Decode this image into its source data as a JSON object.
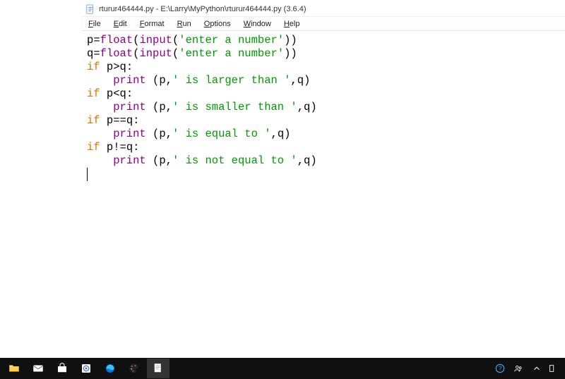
{
  "window": {
    "title": "rturur464444.py - E:\\Larry\\MyPython\\rturur464444.py (3.6.4)"
  },
  "menubar": {
    "items": [
      "File",
      "Edit",
      "Format",
      "Run",
      "Options",
      "Window",
      "Help"
    ]
  },
  "code": {
    "lines": [
      [
        {
          "t": "id",
          "v": "p"
        },
        {
          "t": "op",
          "v": "="
        },
        {
          "t": "builtin",
          "v": "float"
        },
        {
          "t": "punc",
          "v": "("
        },
        {
          "t": "builtin",
          "v": "input"
        },
        {
          "t": "punc",
          "v": "("
        },
        {
          "t": "str",
          "v": "'enter a number'"
        },
        {
          "t": "punc",
          "v": "))"
        }
      ],
      [
        {
          "t": "id",
          "v": "q"
        },
        {
          "t": "op",
          "v": "="
        },
        {
          "t": "builtin",
          "v": "float"
        },
        {
          "t": "punc",
          "v": "("
        },
        {
          "t": "builtin",
          "v": "input"
        },
        {
          "t": "punc",
          "v": "("
        },
        {
          "t": "str",
          "v": "'enter a number'"
        },
        {
          "t": "punc",
          "v": "))"
        }
      ],
      [
        {
          "t": "kw",
          "v": "if"
        },
        {
          "t": "id",
          "v": " p"
        },
        {
          "t": "op",
          "v": ">"
        },
        {
          "t": "id",
          "v": "q"
        },
        {
          "t": "punc",
          "v": ":"
        }
      ],
      [
        {
          "t": "indent",
          "v": "    "
        },
        {
          "t": "builtin",
          "v": "print"
        },
        {
          "t": "id",
          "v": " "
        },
        {
          "t": "punc",
          "v": "("
        },
        {
          "t": "id",
          "v": "p"
        },
        {
          "t": "punc",
          "v": ","
        },
        {
          "t": "str",
          "v": "' is larger than '"
        },
        {
          "t": "punc",
          "v": ","
        },
        {
          "t": "id",
          "v": "q"
        },
        {
          "t": "punc",
          "v": ")"
        }
      ],
      [
        {
          "t": "kw",
          "v": "if"
        },
        {
          "t": "id",
          "v": " p"
        },
        {
          "t": "op",
          "v": "<"
        },
        {
          "t": "id",
          "v": "q"
        },
        {
          "t": "punc",
          "v": ":"
        }
      ],
      [
        {
          "t": "indent",
          "v": "    "
        },
        {
          "t": "builtin",
          "v": "print"
        },
        {
          "t": "id",
          "v": " "
        },
        {
          "t": "punc",
          "v": "("
        },
        {
          "t": "id",
          "v": "p"
        },
        {
          "t": "punc",
          "v": ","
        },
        {
          "t": "str",
          "v": "' is smaller than '"
        },
        {
          "t": "punc",
          "v": ","
        },
        {
          "t": "id",
          "v": "q"
        },
        {
          "t": "punc",
          "v": ")"
        }
      ],
      [
        {
          "t": "kw",
          "v": "if"
        },
        {
          "t": "id",
          "v": " p"
        },
        {
          "t": "op",
          "v": "=="
        },
        {
          "t": "id",
          "v": "q"
        },
        {
          "t": "punc",
          "v": ":"
        }
      ],
      [
        {
          "t": "indent",
          "v": "    "
        },
        {
          "t": "builtin",
          "v": "print"
        },
        {
          "t": "id",
          "v": " "
        },
        {
          "t": "punc",
          "v": "("
        },
        {
          "t": "id",
          "v": "p"
        },
        {
          "t": "punc",
          "v": ","
        },
        {
          "t": "str",
          "v": "' is equal to '"
        },
        {
          "t": "punc",
          "v": ","
        },
        {
          "t": "id",
          "v": "q"
        },
        {
          "t": "punc",
          "v": ")"
        }
      ],
      [
        {
          "t": "kw",
          "v": "if"
        },
        {
          "t": "id",
          "v": " p"
        },
        {
          "t": "op",
          "v": "!="
        },
        {
          "t": "id",
          "v": "q"
        },
        {
          "t": "punc",
          "v": ":"
        }
      ],
      [
        {
          "t": "indent",
          "v": "    "
        },
        {
          "t": "builtin",
          "v": "print"
        },
        {
          "t": "id",
          "v": " "
        },
        {
          "t": "punc",
          "v": "("
        },
        {
          "t": "id",
          "v": "p"
        },
        {
          "t": "punc",
          "v": ","
        },
        {
          "t": "str",
          "v": "' is not equal to '"
        },
        {
          "t": "punc",
          "v": ","
        },
        {
          "t": "id",
          "v": "q"
        },
        {
          "t": "punc",
          "v": ")"
        }
      ]
    ]
  },
  "taskbar": {
    "icons": [
      "file-explorer",
      "mail",
      "store",
      "chrome",
      "edge",
      "paint",
      "notepad"
    ],
    "tray": [
      "help",
      "people",
      "chevron-up",
      "more"
    ]
  }
}
